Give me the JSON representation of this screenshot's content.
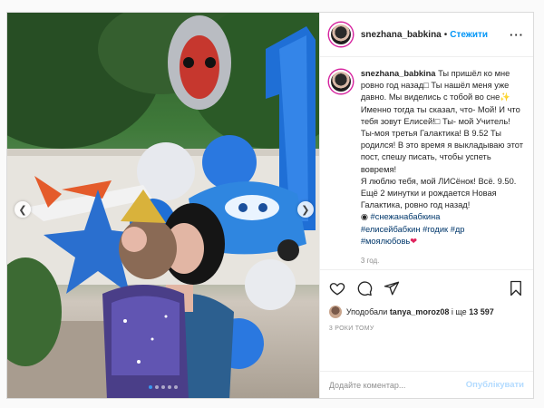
{
  "post": {
    "username": "snezhana_babkina",
    "separator": "•",
    "follow_label": "Стежити",
    "more_label": "···",
    "caption": {
      "username": "snezhana_babkina",
      "lines": [
        "Ты пришёл ко мне ровно год назад",
        "Ты нашёл меня уже давно. Мы виделись с тобой во сне",
        "Именно тогда ты сказал, что- Мой! И что тебя зовут Елисей!",
        "Ты- мой Учитель! Ты-моя третья Галактика! В 9.52 Ты родился! В это время я выкладываю этот пост, спешу писать, чтобы успеть вовремя!",
        "Я люблю тебя, мой ЛИСёнок! Всё. 9.50. Ещё 2 минутки и рождается Новая Галактика, ровно год назад!"
      ],
      "hashtags": [
        "#снежанабабкина",
        "#елисейбабкин",
        "#годик",
        "#др",
        "#моялюбовь"
      ],
      "time_ago": "3 год."
    },
    "likes": {
      "liked_by_label": "Уподобали",
      "liked_by_user": "tanya_moroz08",
      "and_label": "і ще",
      "count": "13 597"
    },
    "posted_ago": "3 РОКИ ТОМУ",
    "comment": {
      "placeholder": "Додайте коментар...",
      "publish_label": "Опублікувати"
    },
    "carousel": {
      "total": 5,
      "active": 0
    }
  }
}
